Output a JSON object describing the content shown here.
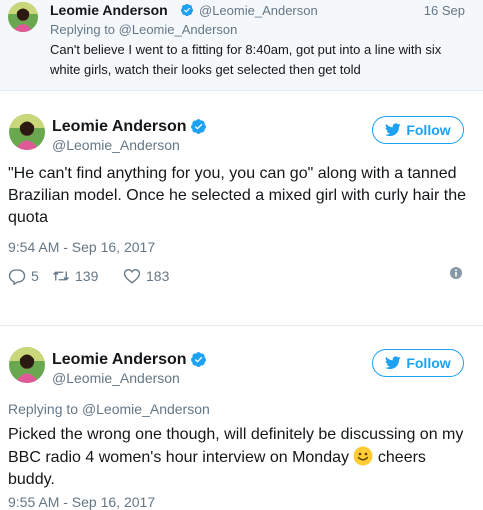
{
  "reply_tweet": {
    "name": "Leomie Anderson",
    "handle": "@Leomie_Anderson",
    "date": "16 Sep",
    "replying_prefix": "Replying to",
    "replying_handle": "@Leomie_Anderson",
    "text": "Can't believe I went to a fitting for 8:40am, got put into a line with six white girls, watch their looks get selected then get told"
  },
  "tweet1": {
    "name": "Leomie Anderson",
    "handle": "@Leomie_Anderson",
    "follow_label": "Follow",
    "text": "\"He can't find anything for you, you can go\" along with a tanned Brazilian model. Once he selected a mixed girl with curly hair the quota",
    "timestamp": "9:54 AM - Sep 16, 2017",
    "replies": "5",
    "retweets": "139",
    "likes": "183"
  },
  "tweet2": {
    "name": "Leomie Anderson",
    "handle": "@Leomie_Anderson",
    "follow_label": "Follow",
    "replying_prefix": "Replying to",
    "replying_handle": "@Leomie_Anderson",
    "text_before_emoji": "Picked the wrong one though, will definitely be discussing on my BBC radio 4 women's hour interview on Monday ",
    "text_after_emoji": " cheers buddy.",
    "timestamp": "9:55 AM - Sep 16, 2017"
  },
  "colors": {
    "accent": "#1da1f2",
    "secondary_text": "#657786",
    "primary_text": "#14171a",
    "reply_bg": "#f5f8fa"
  },
  "icons": {
    "verified": "verified-badge-icon",
    "bird": "twitter-bird-icon",
    "reply": "reply-icon",
    "retweet": "retweet-icon",
    "like": "heart-icon",
    "info": "info-icon",
    "emoji": "smiley-emoji-icon"
  }
}
